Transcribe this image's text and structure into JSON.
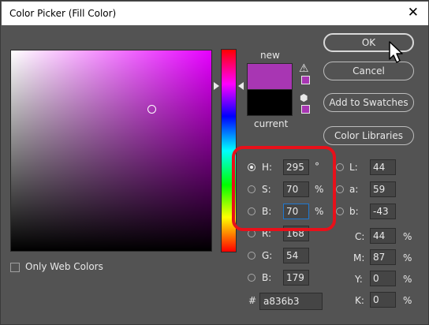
{
  "window": {
    "title": "Color Picker (Fill Color)"
  },
  "icons": {
    "close": "close-icon",
    "warning": "gamut-warning-icon",
    "cube": "web-safe-cube-icon",
    "cursor": "mouse-cursor-icon"
  },
  "colors": {
    "new": "#a836b3",
    "current": "#000000",
    "highlight": "#e8101a",
    "focus": "#1e78d0"
  },
  "preview": {
    "new_label": "new",
    "current_label": "current"
  },
  "buttons": {
    "ok": "OK",
    "cancel": "Cancel",
    "add_to_swatches": "Add to Swatches",
    "color_libraries": "Color Libraries"
  },
  "fields": {
    "H": {
      "label": "H:",
      "value": "295",
      "unit": "°"
    },
    "S": {
      "label": "S:",
      "value": "70",
      "unit": "%"
    },
    "Bv": {
      "label": "B:",
      "value": "70",
      "unit": "%"
    },
    "R": {
      "label": "R:",
      "value": "168"
    },
    "G": {
      "label": "G:",
      "value": "54"
    },
    "Bl": {
      "label": "B:",
      "value": "179"
    },
    "L": {
      "label": "L:",
      "value": "44"
    },
    "a": {
      "label": "a:",
      "value": "59"
    },
    "b": {
      "label": "b:",
      "value": "-43"
    },
    "C": {
      "label": "C:",
      "value": "44",
      "unit": "%"
    },
    "M": {
      "label": "M:",
      "value": "87",
      "unit": "%"
    },
    "Y": {
      "label": "Y:",
      "value": "0",
      "unit": "%"
    },
    "K": {
      "label": "K:",
      "value": "0",
      "unit": "%"
    }
  },
  "hex": {
    "prefix": "#",
    "value": "a836b3"
  },
  "only_web_colors": {
    "label": "Only Web Colors",
    "checked": false
  }
}
